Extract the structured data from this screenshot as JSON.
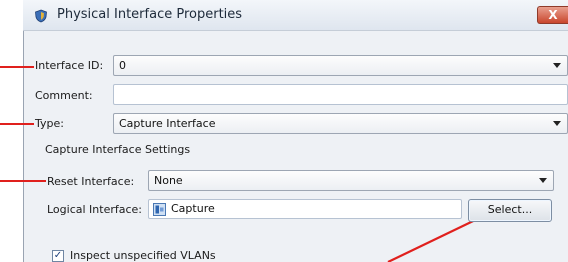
{
  "window": {
    "title": "Physical Interface Properties",
    "close_glyph": "X"
  },
  "form": {
    "interface_id": {
      "label": "Interface ID:",
      "value": "0"
    },
    "comment": {
      "label": "Comment:",
      "value": ""
    },
    "type": {
      "label": "Type:",
      "value": "Capture Interface"
    },
    "section_title": "Capture Interface Settings",
    "reset_interface": {
      "label": "Reset Interface:",
      "value": "None"
    },
    "logical_interface": {
      "label": "Logical Interface:",
      "value": "Capture",
      "button": "Select..."
    },
    "inspect_vlans": {
      "label": "Inspect unspecified VLANs",
      "checked": true
    }
  },
  "colors": {
    "callout": "#e0201d",
    "close": "#c9462d"
  },
  "icons": [
    "shield-app-icon",
    "chevron-down-icon",
    "logical-interface-icon",
    "checkmark-icon"
  ]
}
